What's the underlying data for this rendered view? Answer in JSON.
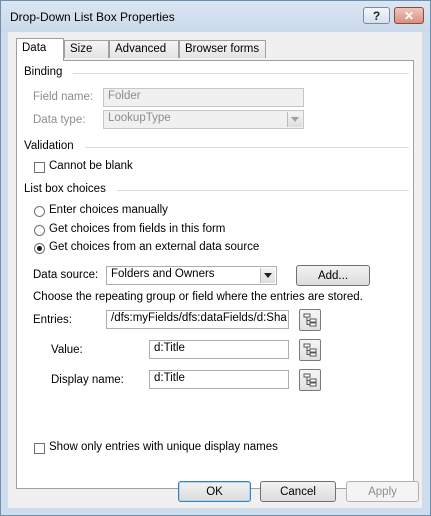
{
  "window": {
    "title": "Drop-Down List Box Properties",
    "help_label": "?",
    "close_label": "✕"
  },
  "tabs": [
    {
      "label": "Data",
      "active": true
    },
    {
      "label": "Size",
      "active": false
    },
    {
      "label": "Advanced",
      "active": false
    },
    {
      "label": "Browser forms",
      "active": false
    }
  ],
  "binding": {
    "section_label": "Binding",
    "field_name_label": "Field name:",
    "field_name_value": "Folder",
    "data_type_label": "Data type:",
    "data_type_value": "LookupType"
  },
  "validation": {
    "section_label": "Validation",
    "cannot_be_blank_label": "Cannot be blank",
    "cannot_be_blank_checked": false
  },
  "choices": {
    "section_label": "List box choices",
    "option_manual": "Enter choices manually",
    "option_fields": "Get choices from fields in this form",
    "option_external": "Get choices from an external data source",
    "selected": "external",
    "data_source_label": "Data source:",
    "data_source_value": "Folders and Owners",
    "add_button": "Add...",
    "instructions": "Choose the repeating group or field where the entries are stored.",
    "entries_label": "Entries:",
    "entries_value": "/dfs:myFields/dfs:dataFields/d:Sha",
    "value_label": "Value:",
    "value_value": "d:Title",
    "display_name_label": "Display name:",
    "display_name_value": "d:Title",
    "unique_label": "Show only entries with unique display names",
    "unique_checked": false
  },
  "footer": {
    "ok": "OK",
    "cancel": "Cancel",
    "apply": "Apply"
  }
}
